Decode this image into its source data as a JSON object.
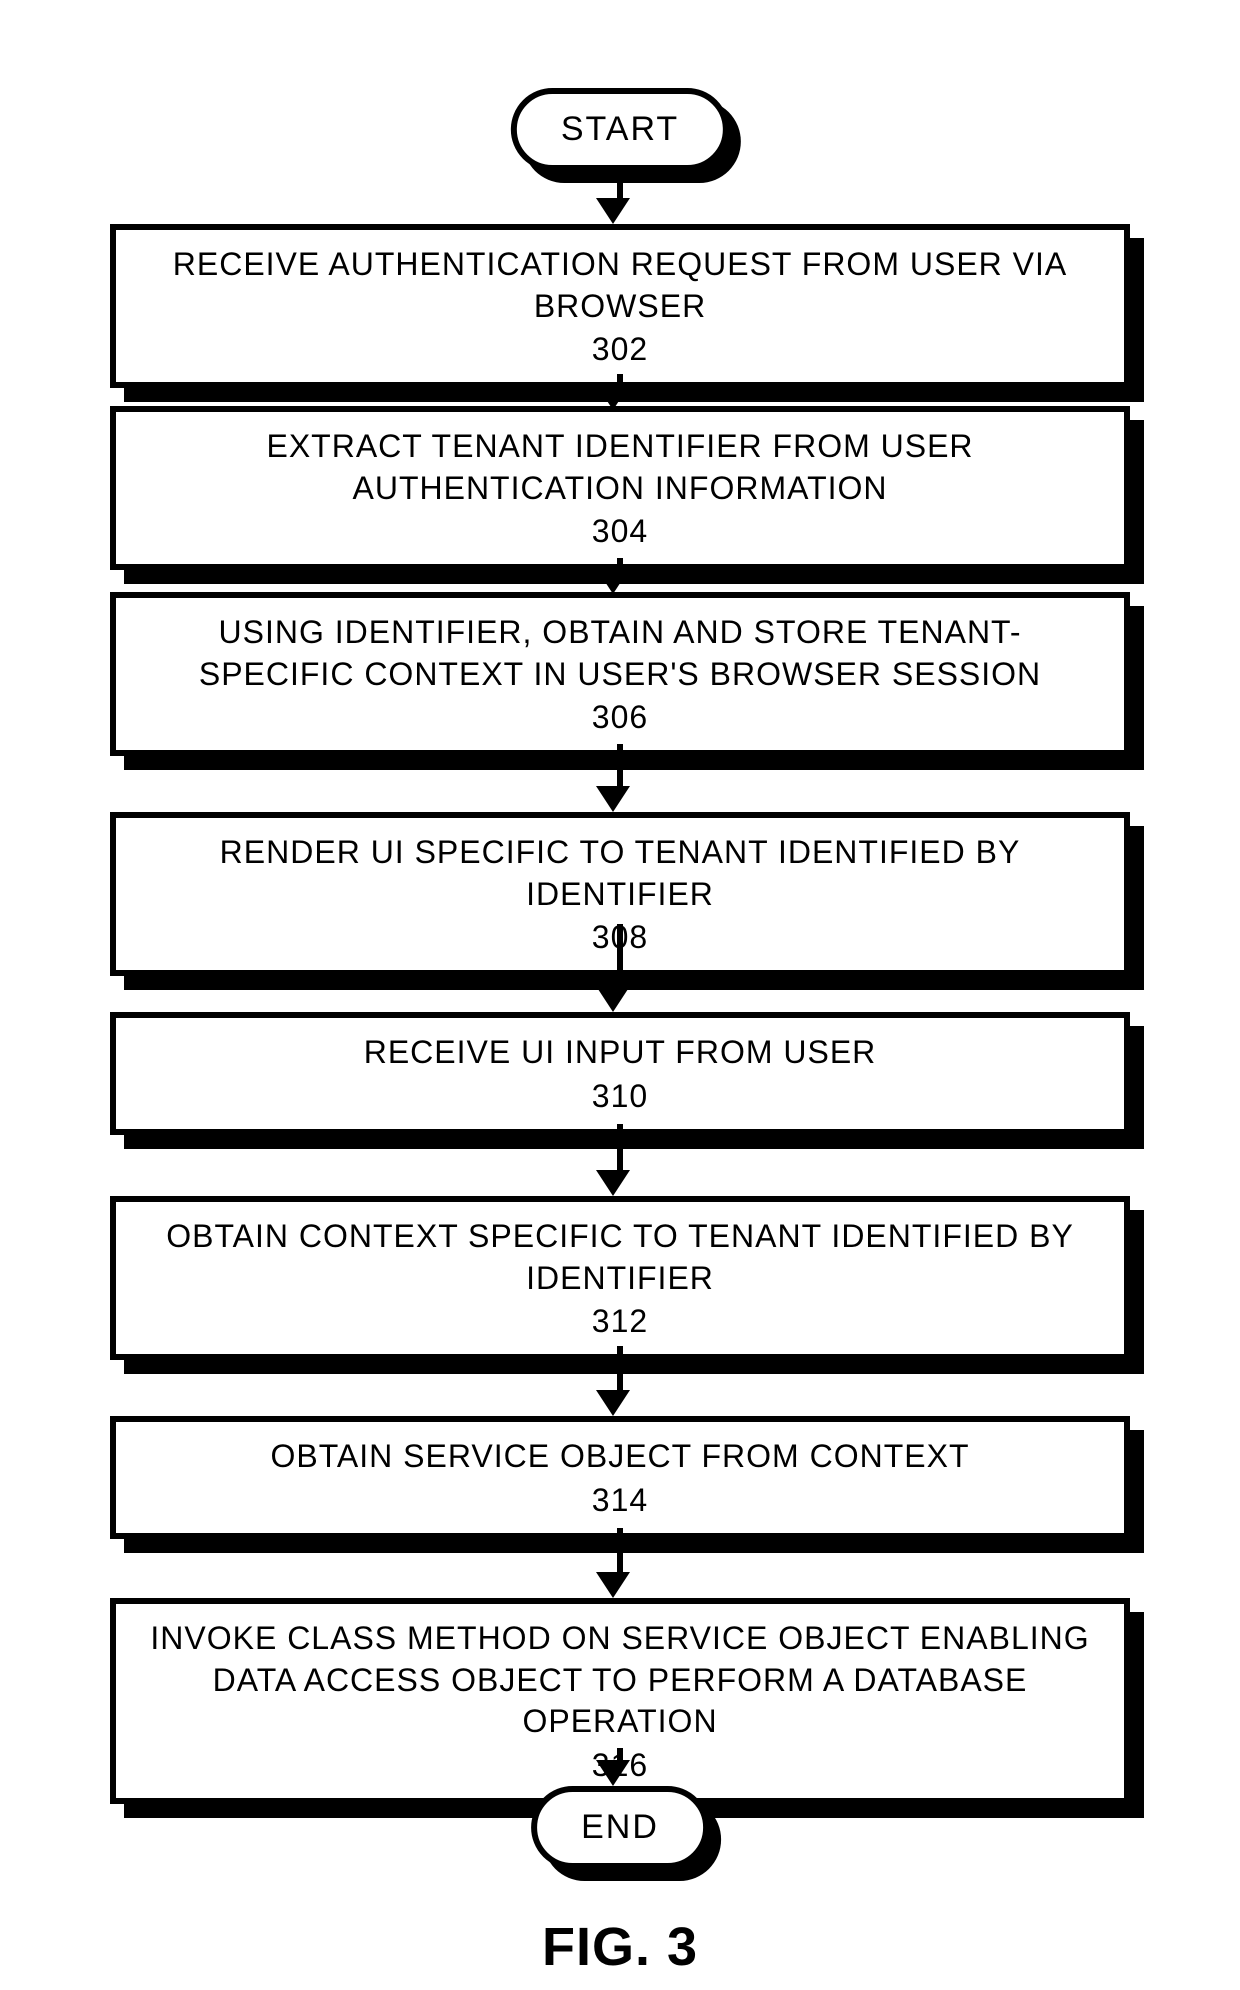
{
  "start_label": "START",
  "end_label": "END",
  "caption": "FIG. 3",
  "steps": [
    {
      "label": "RECEIVE AUTHENTICATION REQUEST FROM USER VIA BROWSER",
      "num": "302"
    },
    {
      "label": "EXTRACT TENANT IDENTIFIER FROM USER AUTHENTICATION INFORMATION",
      "num": "304"
    },
    {
      "label": "USING IDENTIFIER, OBTAIN AND STORE TENANT-SPECIFIC CONTEXT IN USER'S BROWSER SESSION",
      "num": "306"
    },
    {
      "label": "RENDER UI SPECIFIC TO TENANT IDENTIFIED BY IDENTIFIER",
      "num": "308"
    },
    {
      "label": "RECEIVE UI INPUT FROM USER",
      "num": "310"
    },
    {
      "label": "OBTAIN CONTEXT SPECIFIC TO TENANT IDENTIFIED BY IDENTIFIER",
      "num": "312"
    },
    {
      "label": "OBTAIN SERVICE OBJECT FROM CONTEXT",
      "num": "314"
    },
    {
      "label": "INVOKE CLASS METHOD ON SERVICE OBJECT ENABLING DATA ACCESS OBJECT TO PERFORM A DATABASE OPERATION",
      "num": "316"
    }
  ]
}
